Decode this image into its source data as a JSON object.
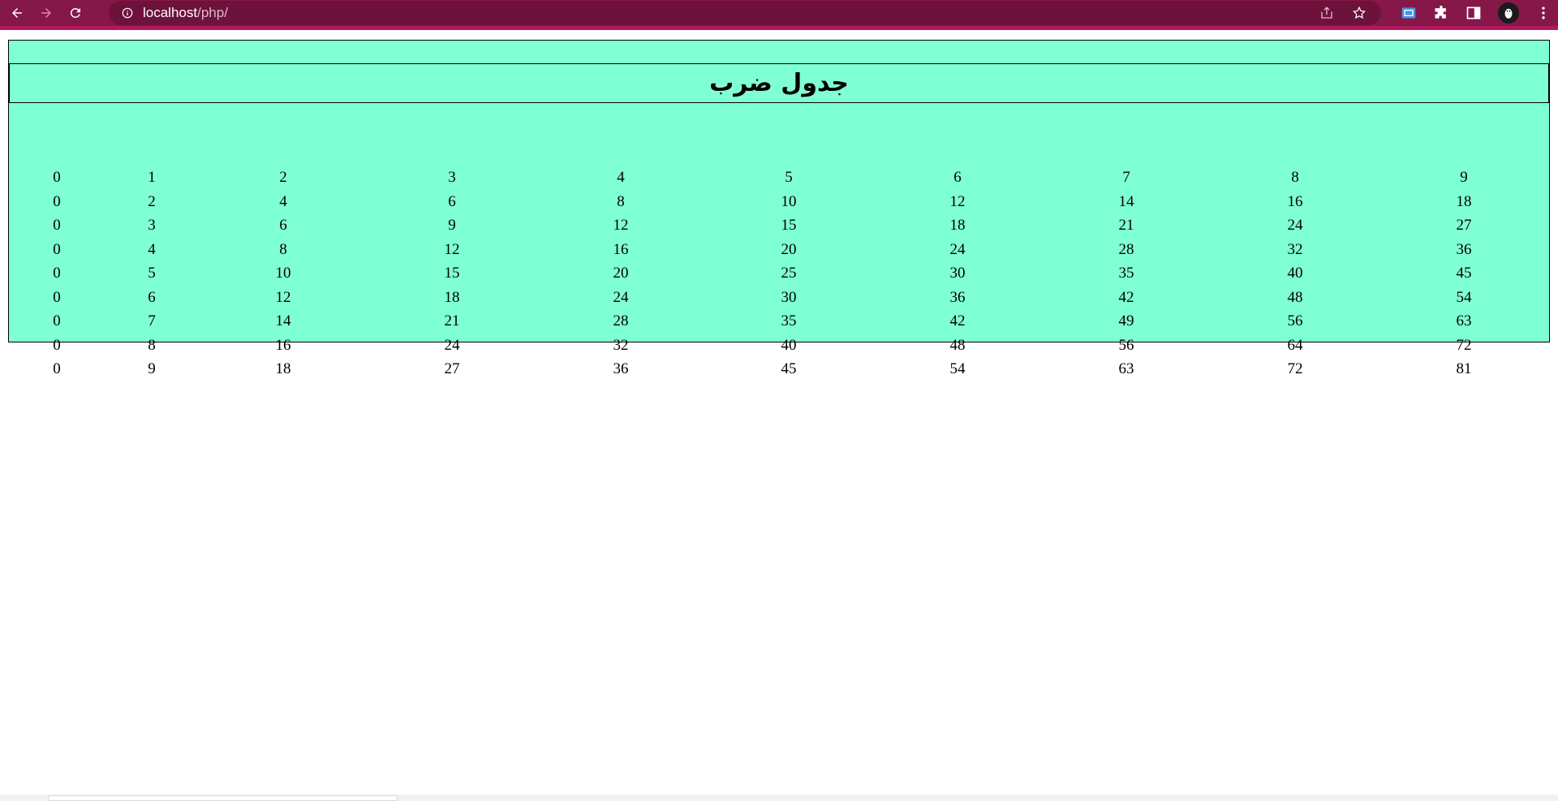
{
  "browser": {
    "url_host": "localhost",
    "url_path": "/php/",
    "icons": {
      "back": "back-arrow-icon",
      "forward": "forward-arrow-icon",
      "reload": "reload-icon",
      "info": "info-icon",
      "share": "share-icon",
      "bookmark": "star-icon",
      "extensions": "puzzle-icon",
      "sidepanel": "side-panel-icon",
      "profile": "avatar-icon",
      "menu": "kebab-menu-icon"
    },
    "colors": {
      "chrome": "#851749",
      "omnibox": "#6c123b"
    }
  },
  "page": {
    "title": "جدول ضرب",
    "background": "#7fffd4",
    "rows": [
      [
        0,
        1,
        2,
        3,
        4,
        5,
        6,
        7,
        8,
        9
      ],
      [
        0,
        2,
        4,
        6,
        8,
        10,
        12,
        14,
        16,
        18
      ],
      [
        0,
        3,
        6,
        9,
        12,
        15,
        18,
        21,
        24,
        27
      ],
      [
        0,
        4,
        8,
        12,
        16,
        20,
        24,
        28,
        32,
        36
      ],
      [
        0,
        5,
        10,
        15,
        20,
        25,
        30,
        35,
        40,
        45
      ],
      [
        0,
        6,
        12,
        18,
        24,
        30,
        36,
        42,
        48,
        54
      ],
      [
        0,
        7,
        14,
        21,
        28,
        35,
        42,
        49,
        56,
        63
      ],
      [
        0,
        8,
        16,
        24,
        32,
        40,
        48,
        56,
        64,
        72
      ],
      [
        0,
        9,
        18,
        27,
        36,
        45,
        54,
        63,
        72,
        81
      ]
    ]
  }
}
